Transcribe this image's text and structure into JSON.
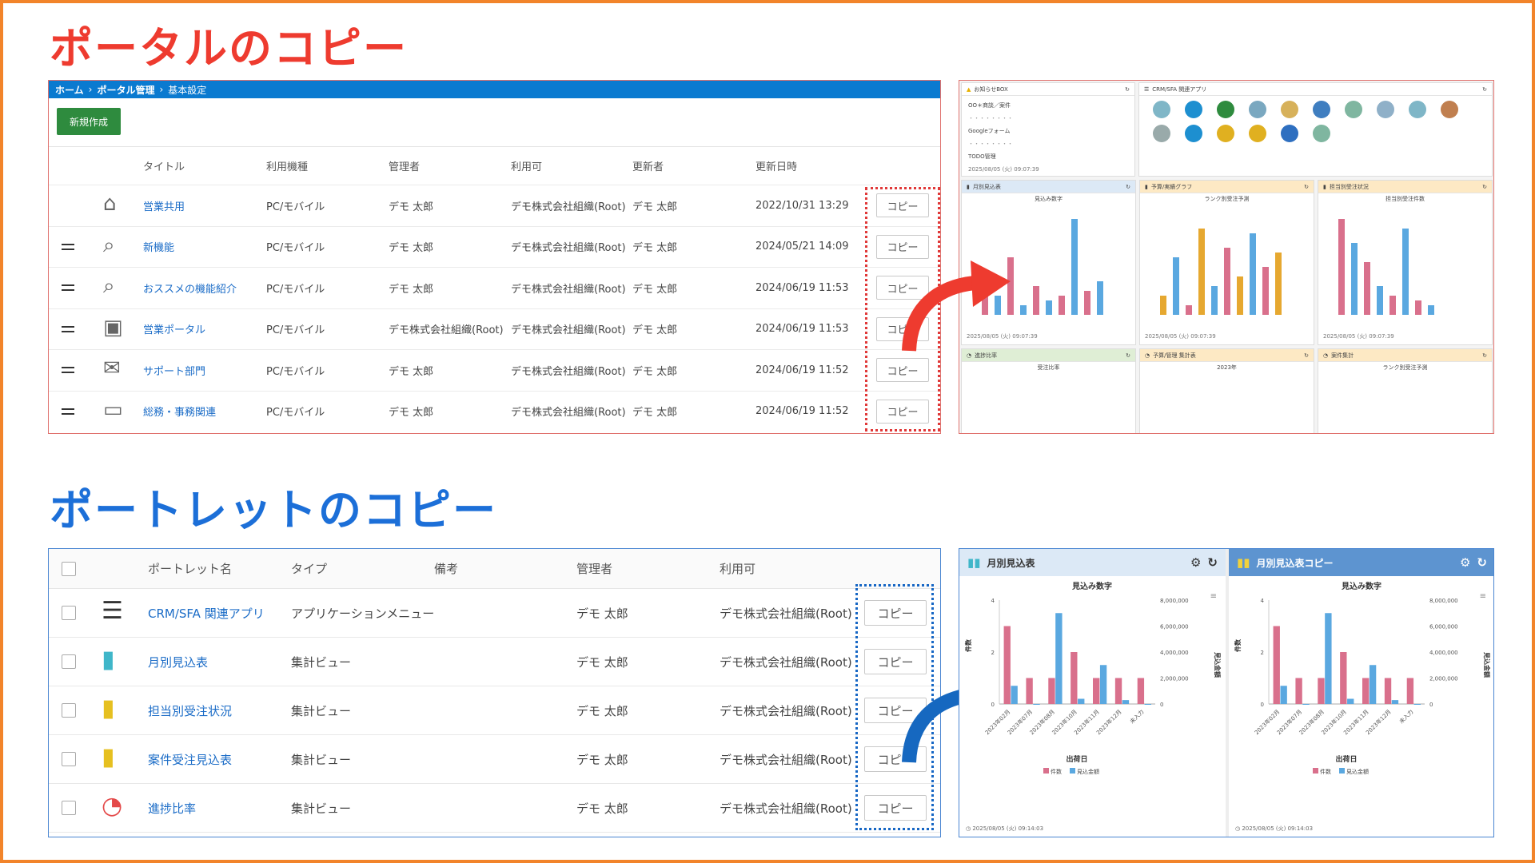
{
  "headings": {
    "portal_copy": "ポータルのコピー",
    "portlet_copy": "ポートレットのコピー"
  },
  "portal_table": {
    "breadcrumb": [
      "ホーム",
      "›",
      "ポータル管理",
      "›",
      "基本設定"
    ],
    "new_button": "新規作成",
    "columns": [
      "タイトル",
      "利用機種",
      "管理者",
      "利用可",
      "更新者",
      "更新日時"
    ],
    "copy_label": "コピー",
    "rows": [
      {
        "icon": "house-icon",
        "title": "営業共用",
        "device": "PC/モバイル",
        "admin": "デモ 太郎",
        "usable": "デモ株式会社組織(Root)",
        "updater": "デモ 太郎",
        "updated": "2022/10/31 13:29",
        "handle": false
      },
      {
        "icon": "magnifier-icon",
        "title": "新機能",
        "device": "PC/モバイル",
        "admin": "デモ 太郎",
        "usable": "デモ株式会社組織(Root)",
        "updater": "デモ 太郎",
        "updated": "2024/05/21 14:09",
        "handle": true
      },
      {
        "icon": "magnifier-icon",
        "title": "おススメの機能紹介",
        "device": "PC/モバイル",
        "admin": "デモ 太郎",
        "usable": "デモ株式会社組織(Root)",
        "updater": "デモ 太郎",
        "updated": "2024/06/19 11:53",
        "handle": true
      },
      {
        "icon": "salesperson-icon",
        "title": "営業ポータル",
        "device": "PC/モバイル",
        "admin": "デモ株式会社組織(Root)",
        "usable": "デモ株式会社組織(Root)",
        "updater": "デモ 太郎",
        "updated": "2024/06/19 11:53",
        "handle": true
      },
      {
        "icon": "chat-icon",
        "title": "サポート部門",
        "device": "PC/モバイル",
        "admin": "デモ 太郎",
        "usable": "デモ株式会社組織(Root)",
        "updater": "デモ 太郎",
        "updated": "2024/06/19 11:52",
        "handle": true
      },
      {
        "icon": "laptop-icon",
        "title": "総務・事務関連",
        "device": "PC/モバイル",
        "admin": "デモ 太郎",
        "usable": "デモ株式会社組織(Root)",
        "updater": "デモ 太郎",
        "updated": "2024/06/19 11:52",
        "handle": true
      }
    ]
  },
  "portal_preview": {
    "notice": {
      "title": "お知らせBOX",
      "items": [
        "OO＊商談／案件",
        "Googleフォーム",
        "TODO管理"
      ],
      "timestamp": "2025/08/05 (火) 09:07:39"
    },
    "crm": {
      "title": "CRM/SFA 関連アプリ"
    },
    "panels": [
      {
        "title": "月別見込表",
        "subtitle": "見込み数字",
        "timestamp": "2025/08/05 (火) 09:07:39"
      },
      {
        "title": "予算/実績グラフ",
        "subtitle": "ランク別受注予測",
        "timestamp": "2025/08/05 (火) 09:07:39"
      },
      {
        "title": "担当別受注状況",
        "subtitle": "担当別受注件数",
        "timestamp": "2025/08/05 (火) 09:07:39"
      }
    ],
    "bottom_panels": [
      {
        "title": "進捗比率",
        "subtitle": "受注比率"
      },
      {
        "title": "予算/管理 集計表",
        "subtitle": "2023年"
      },
      {
        "title": "案件集計",
        "subtitle": "ランク別受注予測"
      }
    ]
  },
  "portlet_table": {
    "columns": [
      "ポートレット名",
      "タイプ",
      "備考",
      "管理者",
      "利用可"
    ],
    "copy_label": "コピー",
    "rows": [
      {
        "icon": "list-icon",
        "name": "CRM/SFA 関連アプリ",
        "type": "アプリケーションメニュー",
        "admin": "デモ 太郎",
        "usable": "デモ株式会社組織(Root)"
      },
      {
        "icon": "bar-chart-icon",
        "name": "月別見込表",
        "type": "集計ビュー",
        "admin": "デモ 太郎",
        "usable": "デモ株式会社組織(Root)"
      },
      {
        "icon": "bar-chart-icon",
        "name": "担当別受注状況",
        "type": "集計ビュー",
        "admin": "デモ 太郎",
        "usable": "デモ株式会社組織(Root)"
      },
      {
        "icon": "bar-chart-icon",
        "name": "案件受注見込表",
        "type": "集計ビュー",
        "admin": "デモ 太郎",
        "usable": "デモ株式会社組織(Root)"
      },
      {
        "icon": "pie-chart-icon",
        "name": "進捗比率",
        "type": "集計ビュー",
        "admin": "デモ 太郎",
        "usable": "デモ株式会社組織(Root)"
      }
    ]
  },
  "chart_data": [
    {
      "type": "bar",
      "title": "月別見込表",
      "subtitle": "見込み数字",
      "xlabel": "出荷日",
      "ylabel": "件数",
      "y2label": "見込金額",
      "categories": [
        "2023年02月",
        "2023年07月",
        "2023年08月",
        "2023年10月",
        "2023年11月",
        "2023年12月",
        "未入力"
      ],
      "series": [
        {
          "name": "件数",
          "axis": "left",
          "values": [
            3,
            1,
            1,
            2,
            1,
            1,
            1
          ],
          "color": "#d9708c"
        },
        {
          "name": "見込金額",
          "axis": "right",
          "values": [
            1400000,
            0,
            7000000,
            400000,
            3000000,
            300000,
            0
          ],
          "color": "#5aa8e0"
        }
      ],
      "ylim": [
        0,
        4
      ],
      "y2lim": [
        0,
        8000000
      ],
      "y_ticks": [
        "0",
        "2",
        "4"
      ],
      "y2_ticks": [
        "0",
        "2,000,000",
        "4,000,000",
        "6,000,000",
        "8,000,000"
      ],
      "timestamp": "2025/08/05 (火) 09:14:03"
    },
    {
      "type": "bar",
      "title": "月別見込表コピー",
      "subtitle": "見込み数字",
      "xlabel": "出荷日",
      "ylabel": "件数",
      "y2label": "見込金額",
      "categories": [
        "2023年02月",
        "2023年07月",
        "2023年08月",
        "2023年10月",
        "2023年11月",
        "2023年12月",
        "未入力"
      ],
      "series": [
        {
          "name": "件数",
          "axis": "left",
          "values": [
            3,
            1,
            1,
            2,
            1,
            1,
            1
          ],
          "color": "#d9708c"
        },
        {
          "name": "見込金額",
          "axis": "right",
          "values": [
            1400000,
            0,
            7000000,
            400000,
            3000000,
            300000,
            0
          ],
          "color": "#5aa8e0"
        }
      ],
      "ylim": [
        0,
        4
      ],
      "y2lim": [
        0,
        8000000
      ],
      "y_ticks": [
        "0",
        "2",
        "4"
      ],
      "y2_ticks": [
        "0",
        "2,000,000",
        "4,000,000",
        "6,000,000",
        "8,000,000"
      ],
      "timestamp": "2025/08/05 (火) 09:14:03"
    }
  ],
  "colors": {
    "accent_red": "#ee3b2f",
    "accent_blue": "#1c6fd8",
    "frame_orange": "#f2842a",
    "pink": "#d9708c",
    "sky": "#5aa8e0"
  }
}
